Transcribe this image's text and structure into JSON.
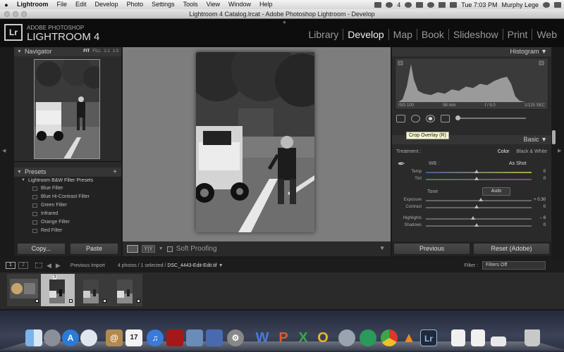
{
  "menubar": {
    "app": "Lightroom",
    "items": [
      "File",
      "Edit",
      "Develop",
      "Photo",
      "Settings",
      "Tools",
      "View",
      "Window",
      "Help"
    ],
    "status_extra": "4",
    "clock": "Tue 7:03 PM",
    "user": "Murphy Lege"
  },
  "window": {
    "title": "Lightroom 4 Catalog.lrcat - Adobe Photoshop Lightroom - Develop"
  },
  "brand": {
    "logo": "Lr",
    "line1": "ADOBE PHOTOSHOP",
    "line2": "LIGHTROOM 4"
  },
  "modules": [
    "Library",
    "Develop",
    "Map",
    "Book",
    "Slideshow",
    "Print",
    "Web"
  ],
  "active_module": "Develop",
  "navigator": {
    "title": "Navigator",
    "options": [
      "FIT",
      "FILL",
      "1:1",
      "1:3"
    ]
  },
  "presets": {
    "title": "Presets",
    "folder": "Lightroom B&W Filter Presets",
    "items": [
      "Blue Filter",
      "Blue Hi-Contrast Filter",
      "Green Filter",
      "Infrared",
      "Orange Filter",
      "Red Filter"
    ]
  },
  "left_buttons": {
    "copy": "Copy...",
    "paste": "Paste"
  },
  "toolbar": {
    "yy": "Y|Y",
    "soft_proofing": "Soft Proofing"
  },
  "histogram": {
    "title": "Histogram",
    "iso": "ISO 100",
    "focal": "58 mm",
    "aperture": "f / 5.0",
    "shutter": "1/125 SEC"
  },
  "tooltip": "Crop Overlay (R)",
  "basic": {
    "title": "Basic",
    "treatment_label": "Treatment :",
    "treatment_color": "Color",
    "treatment_bw": "Black & White",
    "wb_label": "WB :",
    "wb_value": "As Shot",
    "temp": {
      "label": "Temp",
      "value": "0"
    },
    "tint": {
      "label": "Tint",
      "value": "0"
    },
    "tone_label": "Tone",
    "auto": "Auto",
    "exposure": {
      "label": "Exposure",
      "value": "+ 0.30"
    },
    "contrast": {
      "label": "Contrast",
      "value": "0"
    },
    "highlights": {
      "label": "Highlights",
      "value": "− 8"
    },
    "shadows": {
      "label": "Shadows",
      "value": "0"
    }
  },
  "right_buttons": {
    "previous": "Previous",
    "reset": "Reset (Adobe)"
  },
  "filmstrip_bar": {
    "screen1": "1",
    "screen2": "2",
    "source": "Previous Import",
    "count": "4 photos / 1 selected /",
    "filename": "DSC_4443-Edit-Edit.tif",
    "filter_label": "Filter :",
    "filter_value": "Filters Off"
  },
  "filmstrip": {
    "selected_number": "3"
  },
  "dock": {
    "icons": [
      "finder-icon",
      "launchpad-icon",
      "app-store-icon",
      "safari-icon",
      "contacts-icon",
      "calendar-icon",
      "itunes-icon",
      "photo-booth-icon",
      "iphoto-icon",
      "preview-icon",
      "system-preferences-icon",
      "word-icon",
      "powerpoint-icon",
      "excel-icon",
      "outlook-icon",
      "network-icon",
      "utility-icon",
      "chrome-icon",
      "vlc-icon",
      "lightroom-dock-icon",
      "document-icon",
      "document-icon",
      "drive-icon",
      "trash-icon"
    ],
    "calendar_day": "17",
    "lr": "Lr"
  },
  "colors": {
    "accent_temp": "#7a8a3a",
    "accent_tint": "#6a3a8a",
    "panel": "#2a2a2a",
    "background": "#1a1a1a"
  }
}
